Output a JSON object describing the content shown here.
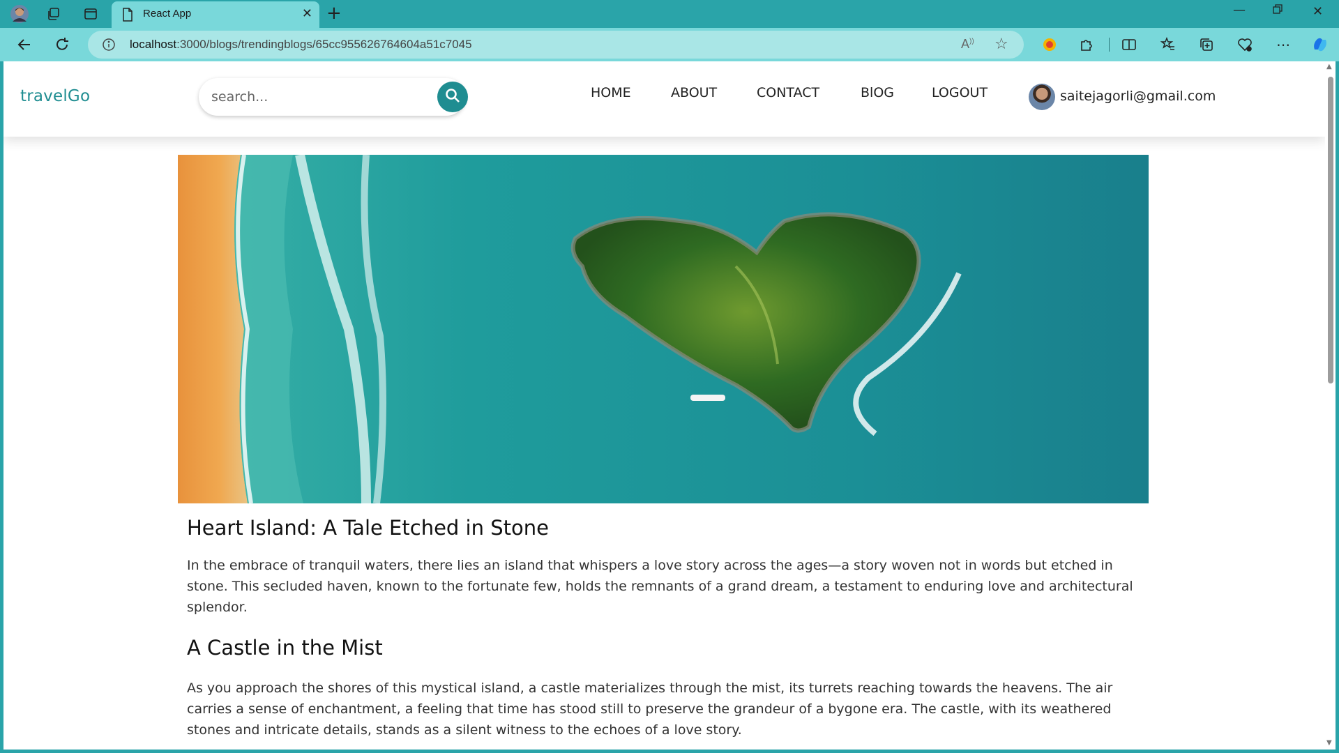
{
  "browser": {
    "tab_title": "React App",
    "url_host": "localhost",
    "url_rest": ":3000/blogs/trendingblogs/65cc955626764604a51c7045"
  },
  "site": {
    "brand": "travelGo",
    "search_placeholder": "search...",
    "nav": [
      "HOME",
      "ABOUT",
      "CONTACT",
      "BlOG",
      "LOGOUT"
    ],
    "user_email": "saitejagorli@gmail.com"
  },
  "article": {
    "title": "Heart Island: A Tale Etched in Stone",
    "intro": "In the embrace of tranquil waters, there lies an island that whispers a love story across the ages—a story woven not in words but etched in stone. This secluded haven, known to the fortunate few, holds the remnants of a grand dream, a testament to enduring love and architectural splendor.",
    "section_title": "A Castle in the Mist",
    "section_text": "As you approach the shores of this mystical island, a castle materializes through the mist, its turrets reaching towards the heavens. The air carries a sense of enchantment, a feeling that time has stood still to preserve the grandeur of a bygone era. The castle, with its weathered stones and intricate details, stands as a silent witness to the echoes of a love story."
  },
  "colors": {
    "accent": "#1f8d91",
    "chrome": "#2aa4a9",
    "tab": "#79d8da"
  }
}
